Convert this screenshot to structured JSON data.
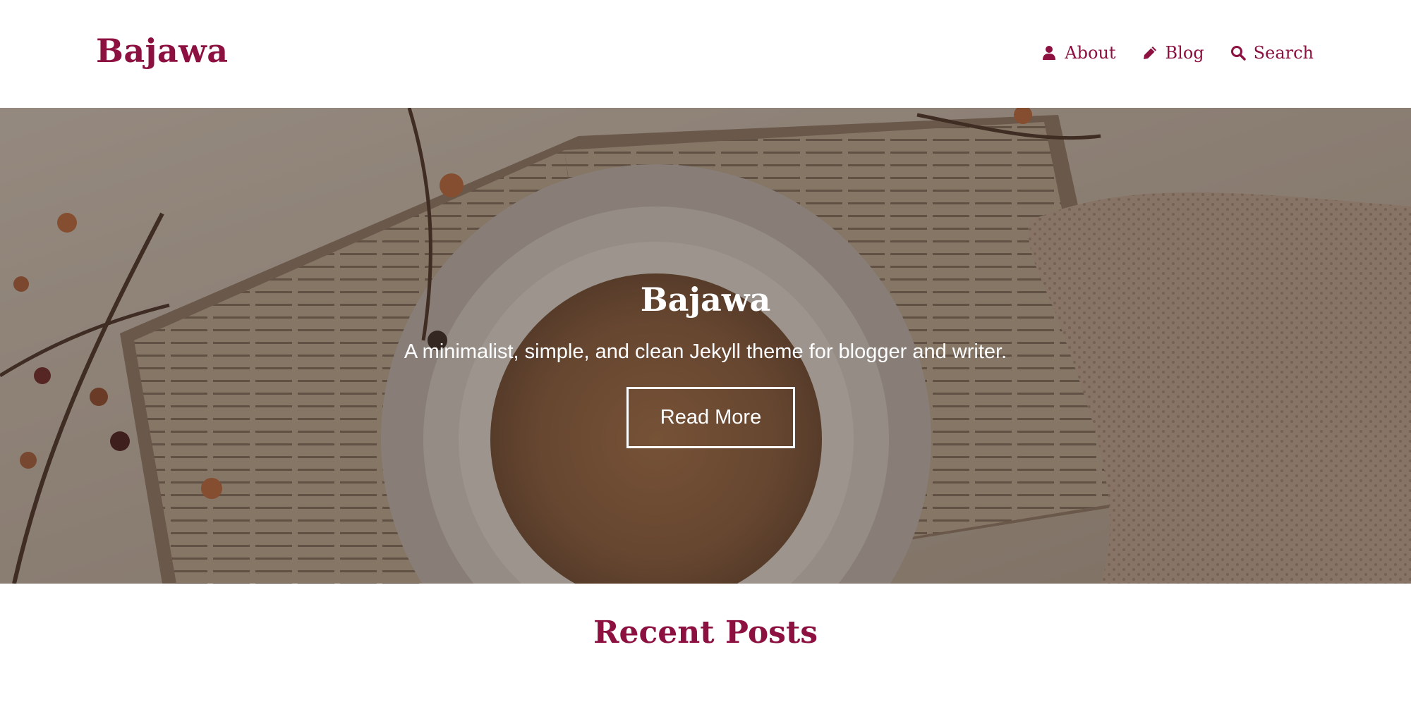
{
  "brand": {
    "name": "Bajawa"
  },
  "nav": {
    "items": [
      {
        "label": "About",
        "icon": "user-icon"
      },
      {
        "label": "Blog",
        "icon": "pencil-icon"
      },
      {
        "label": "Search",
        "icon": "search-icon"
      }
    ]
  },
  "hero": {
    "title": "Bajawa",
    "subtitle": "A minimalist, simple, and clean Jekyll theme for blogger and writer.",
    "button_label": "Read More"
  },
  "recent": {
    "title": "Recent Posts"
  },
  "colors": {
    "accent": "#8c1040",
    "text_on_hero": "#ffffff",
    "background": "#ffffff"
  }
}
